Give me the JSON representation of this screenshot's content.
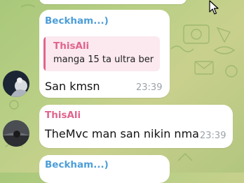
{
  "colors": {
    "chat_background": "#b9cf86",
    "bubble": "#ffffff",
    "beckham_name": "#4d9ed8",
    "thisali_name": "#e0658c",
    "reply_bar": "#e0658c",
    "reply_background": "#fbe9ef",
    "time": "#9aa3a8"
  },
  "messages": [
    {
      "sender": "Beckham...)",
      "reply": {
        "sender": "ThisAli",
        "text": "manga 15 ta ultra ber"
      },
      "text": "San kmsn",
      "time": "23:39"
    },
    {
      "sender": "ThisAli",
      "text": "TheMvc man san nikin nma",
      "time": "23:39"
    },
    {
      "sender": "Beckham...)"
    }
  ],
  "cursor": {
    "icon": "mouse-pointer-icon"
  }
}
